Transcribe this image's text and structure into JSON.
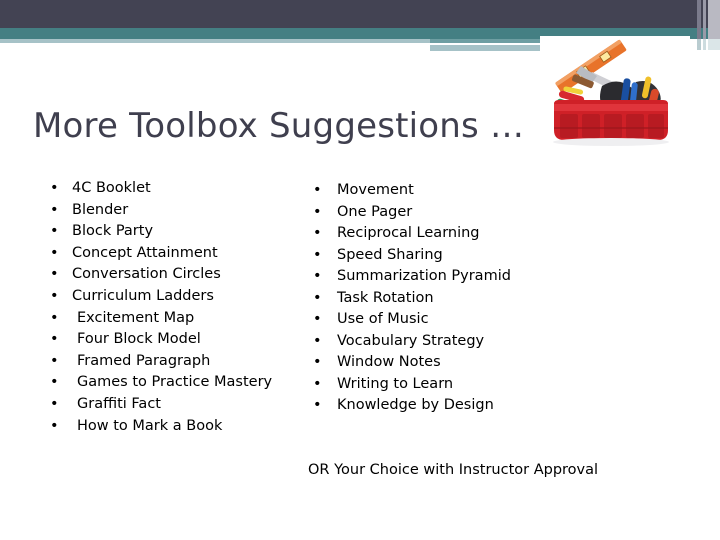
{
  "slide": {
    "title": "More Toolbox Suggestions …",
    "footer_note": "OR   Your Choice with Instructor Approval",
    "bullet_glyph": "•"
  },
  "colors": {
    "header_dark": "#434353",
    "header_teal": "#447f83",
    "header_light": "#a6c2c7",
    "title_text": "#3f3f4e",
    "body_text": "#000000",
    "toolbox_red": "#cf2027",
    "level_orange": "#e8732a"
  },
  "image": {
    "toolbox": "red-toolbox-with-tools-photo"
  },
  "left_column": [
    {
      "label": "4C Booklet",
      "indented": false
    },
    {
      "label": "Blender",
      "indented": false
    },
    {
      "label": "Block Party",
      "indented": false
    },
    {
      "label": "Concept Attainment",
      "indented": false
    },
    {
      "label": "Conversation Circles",
      "indented": false
    },
    {
      "label": "Curriculum Ladders",
      "indented": false
    },
    {
      "label": "Excitement Map",
      "indented": true
    },
    {
      "label": "Four Block Model",
      "indented": true
    },
    {
      "label": "Framed Paragraph",
      "indented": true
    },
    {
      "label": "Games to Practice Mastery",
      "indented": true
    },
    {
      "label": "Graffiti Fact",
      "indented": true
    },
    {
      "label": "How to Mark a Book",
      "indented": true
    }
  ],
  "right_column": [
    {
      "label": "Movement"
    },
    {
      "label": "One Pager"
    },
    {
      "label": "Reciprocal Learning"
    },
    {
      "label": "Speed Sharing"
    },
    {
      "label": "Summarization Pyramid"
    },
    {
      "label": "Task Rotation"
    },
    {
      "label": "Use of Music"
    },
    {
      "label": "Vocabulary Strategy"
    },
    {
      "label": "Window Notes"
    },
    {
      "label": "Writing to Learn"
    },
    {
      "label": "Knowledge by Design"
    }
  ]
}
